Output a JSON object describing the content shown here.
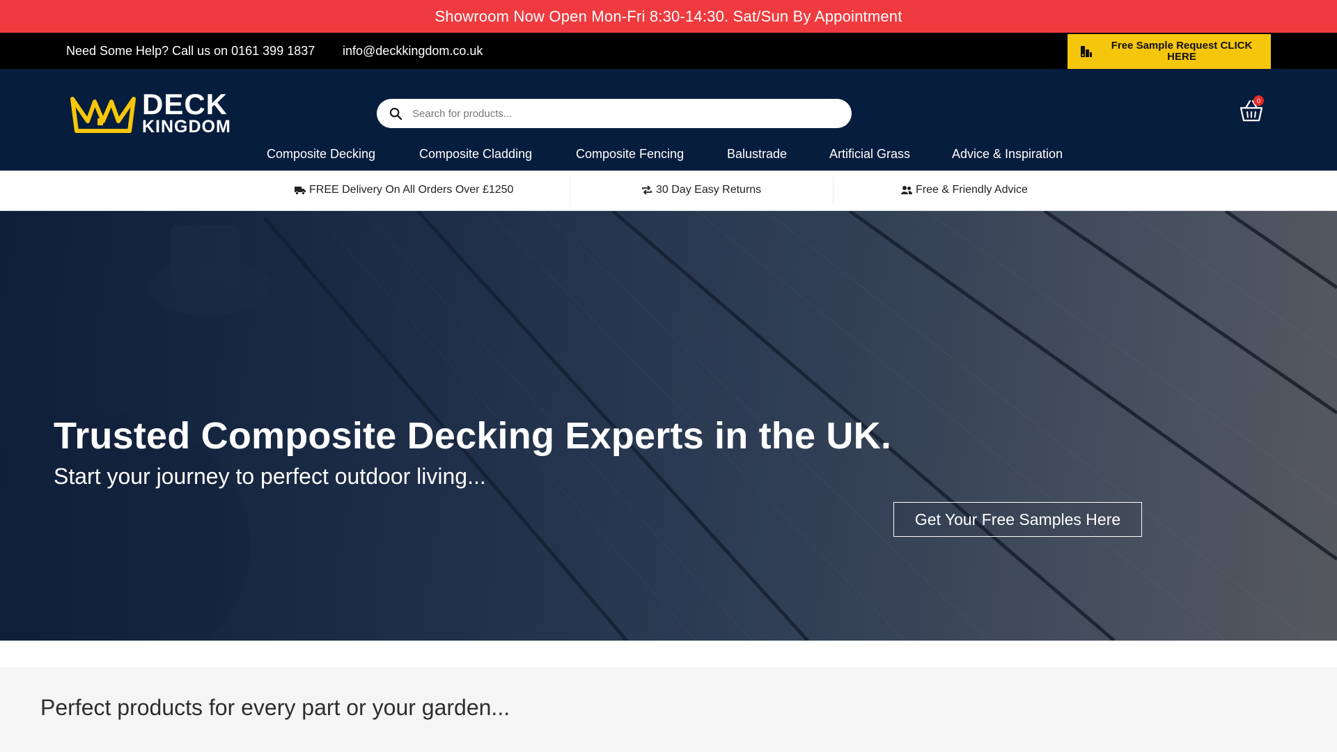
{
  "announcement": {
    "text": "Showroom Now Open Mon-Fri 8:30-14:30. Sat/Sun By Appointment"
  },
  "contact_bar": {
    "phone_text": "Need Some Help? Call us on 0161 399 1837",
    "email_text": "info@deckkingdom.co.uk",
    "sample_button_label": "Free Sample Request CLICK HERE"
  },
  "header": {
    "logo_line1": "DECK",
    "logo_line2": "KINGDOM",
    "search_placeholder": "Search for products...",
    "cart_count": "0"
  },
  "nav": {
    "items": [
      {
        "label": "Composite Decking"
      },
      {
        "label": "Composite Cladding"
      },
      {
        "label": "Composite Fencing"
      },
      {
        "label": "Balustrade"
      },
      {
        "label": "Artificial Grass"
      },
      {
        "label": "Advice & Inspiration"
      }
    ]
  },
  "usp": {
    "items": [
      {
        "label": "FREE Delivery On All Orders Over £1250",
        "icon": "truck-icon"
      },
      {
        "label": "30 Day Easy Returns",
        "icon": "returns-icon"
      },
      {
        "label": "Free & Friendly Advice",
        "icon": "users-icon"
      }
    ]
  },
  "hero": {
    "title": "Trusted Composite Decking Experts in the UK.",
    "subtitle": "Start your journey to perfect outdoor living...",
    "cta_label": "Get Your Free Samples Here"
  },
  "section": {
    "heading": "Perfect products for every part or your garden..."
  },
  "colors": {
    "announcement_bg": "#ef3b3f",
    "header_bg": "#071d3d",
    "sample_button_bg": "#f6c60c",
    "logo_gold": "#f6c60c"
  }
}
